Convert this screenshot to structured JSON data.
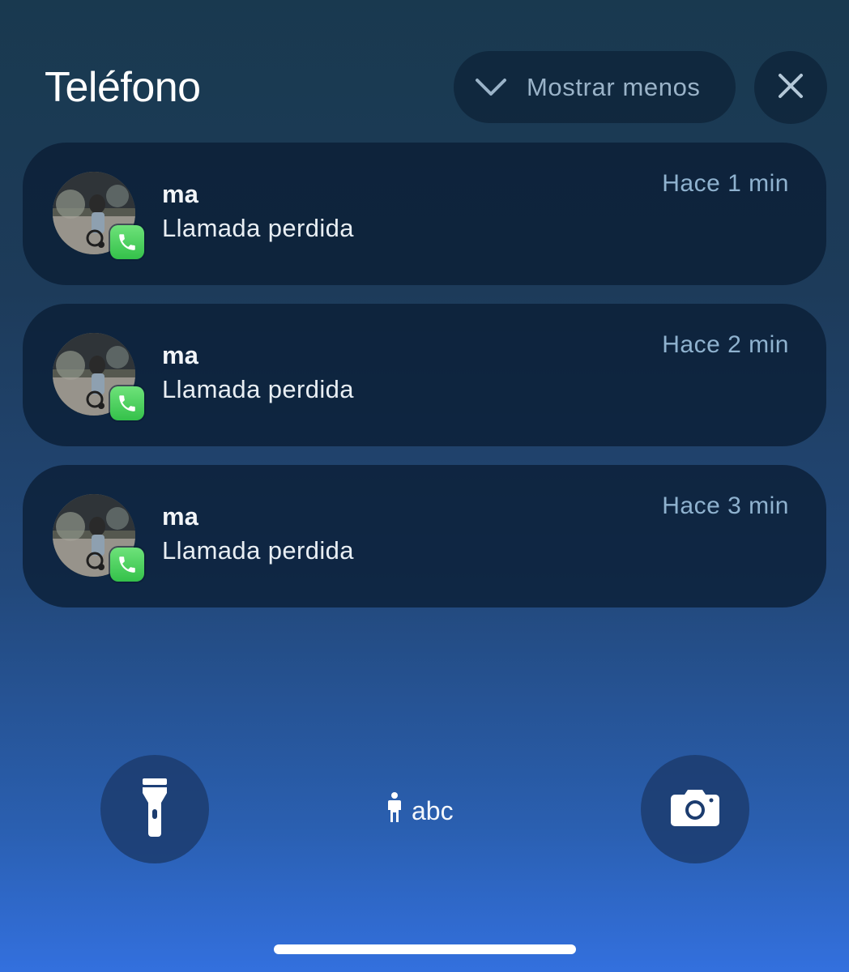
{
  "header": {
    "app_title": "Teléfono",
    "show_less_label": "Mostrar menos"
  },
  "notifications": [
    {
      "sender": "ma",
      "message": "Llamada perdida",
      "time": "Hace 1 min"
    },
    {
      "sender": "ma",
      "message": "Llamada perdida",
      "time": "Hace 2 min"
    },
    {
      "sender": "ma",
      "message": "Llamada perdida",
      "time": "Hace 3 min"
    }
  ],
  "lockscreen": {
    "carrier_label": "abc",
    "left_button_icon": "flashlight-icon",
    "right_button_icon": "camera-icon"
  },
  "colors": {
    "badge_green": "#4cd964",
    "time_text": "#8fb2cf",
    "card_bg": "#0a1e34"
  }
}
